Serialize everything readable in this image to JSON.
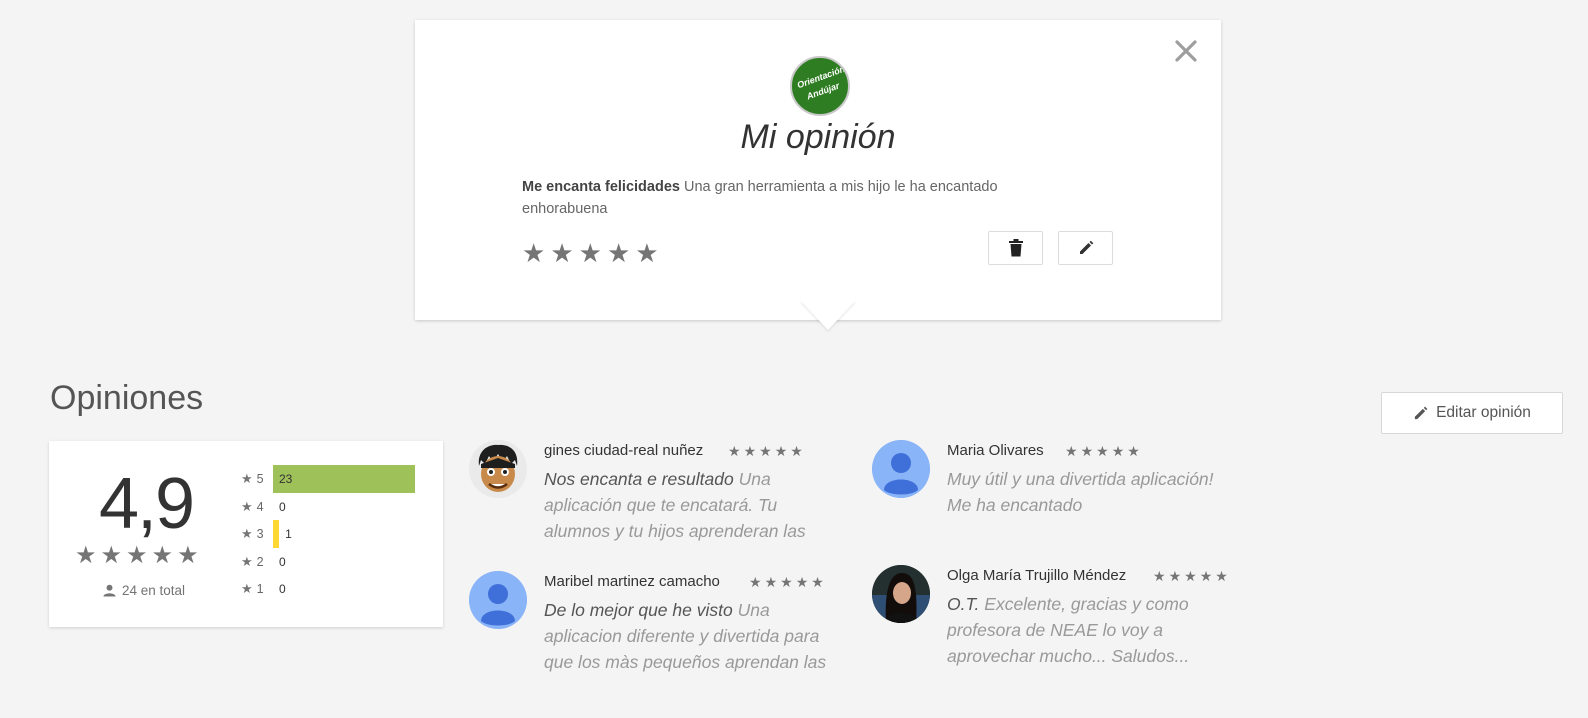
{
  "popup": {
    "close_symbol": "✕",
    "logo_text_1": "Orientación",
    "logo_text_2": "Andújar",
    "title": "Mi opinión",
    "review_title": "Me encanta felicidades",
    "review_body": "Una gran herramienta a mis hijo le ha encantado enhorabuena",
    "rating": 5,
    "delete_icon": "trash-icon",
    "edit_icon": "pencil-icon"
  },
  "opinions": {
    "title": "Opiniones",
    "edit_button_label": "Editar opinión",
    "average": "4,9",
    "total_text": "24 en total",
    "histogram": [
      {
        "stars": "5",
        "count": "23",
        "fraction": 1.0,
        "color": "#9fc15a"
      },
      {
        "stars": "4",
        "count": "0",
        "fraction": 0,
        "color": "#9fc15a"
      },
      {
        "stars": "3",
        "count": "1",
        "fraction": 0.043,
        "color": "#fdd835"
      },
      {
        "stars": "2",
        "count": "0",
        "fraction": 0,
        "color": "#9fc15a"
      },
      {
        "stars": "1",
        "count": "0",
        "fraction": 0,
        "color": "#9fc15a"
      }
    ]
  },
  "reviews": [
    {
      "name": "gines ciudad-real nuñez",
      "title": "Nos encanta e resultado",
      "body": "Una aplicación que te encatará. Tu alumnos y tu hijos aprenderan las",
      "rating": 5,
      "avatar": "cartoon-avatar"
    },
    {
      "name": "Maria Olivares",
      "title": "",
      "body": "Muy útil y una divertida aplicación! Me ha encantado",
      "rating": 5,
      "avatar": "default-user-avatar"
    },
    {
      "name": "Maribel martinez camacho",
      "title": "De lo mejor que he visto",
      "body": "Una aplicacion diferente y divertida para que los màs pequeños aprendan las",
      "rating": 5,
      "avatar": "default-user-avatar"
    },
    {
      "name": "Olga María Trujillo Méndez",
      "title": "O.T.",
      "body": "Excelente, gracias y como profesora de NEAE lo voy a aprovechar mucho... Saludos...",
      "rating": 5,
      "avatar": "photo-avatar"
    }
  ],
  "colors": {
    "background": "#f4f4f4",
    "star": "#757575",
    "bar_green": "#9fc15a",
    "bar_yellow": "#fdd835",
    "avatar_blue": "#8ab4f8"
  }
}
